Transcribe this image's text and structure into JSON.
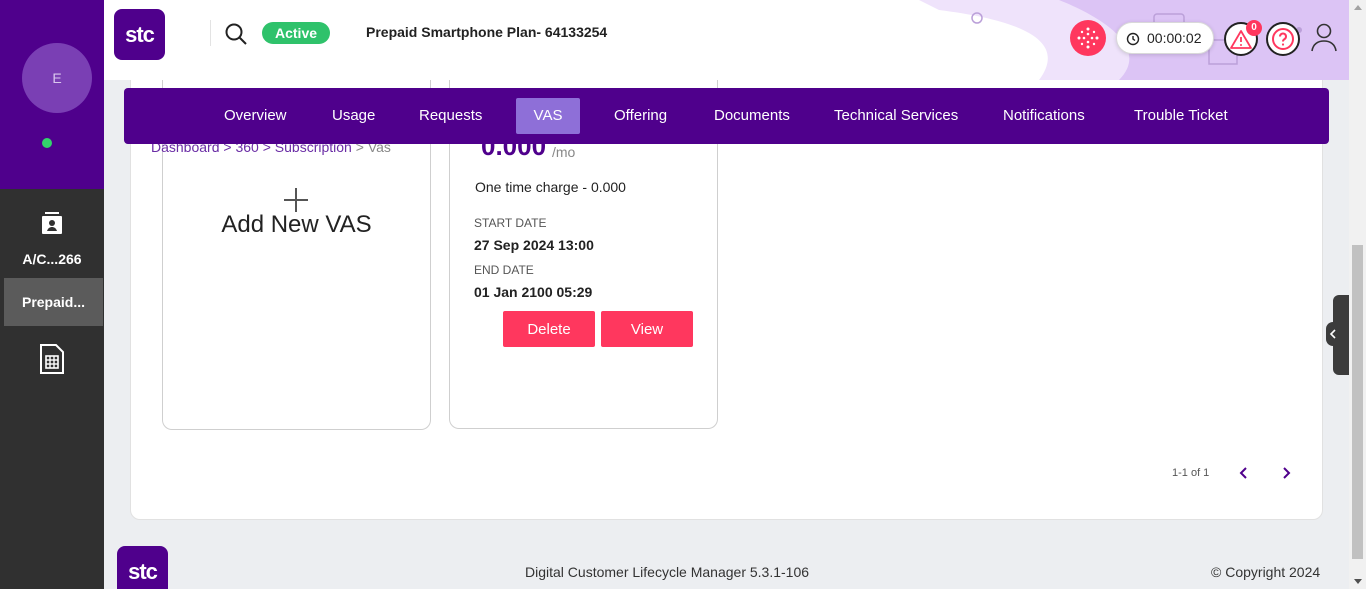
{
  "colors": {
    "brand": "#4f008c",
    "accent": "#ff375e",
    "active_tab": "#8e6fd8",
    "status_active": "#2fc26b"
  },
  "rail": {
    "avatar_initial": "E",
    "account_label": "A/C...266",
    "prepaid_label": "Prepaid..."
  },
  "header": {
    "logo_text": "stc",
    "status": "Active",
    "plan_title": "Prepaid Smartphone Plan- 64133254",
    "timer": "00:00:02",
    "alerts_count": "0"
  },
  "tabs": [
    {
      "label": "Overview"
    },
    {
      "label": "Usage"
    },
    {
      "label": "Requests"
    },
    {
      "label": "VAS",
      "active": true
    },
    {
      "label": "Offering"
    },
    {
      "label": "Documents"
    },
    {
      "label": "Technical Services"
    },
    {
      "label": "Notifications"
    },
    {
      "label": "Trouble Ticket"
    }
  ],
  "breadcrumb": {
    "dashboard": "Dashboard",
    "view360": "360",
    "subscription": "Subscription",
    "current": "Vas",
    "sep": ">"
  },
  "add_card": {
    "label": "Add New VAS"
  },
  "vas_card": {
    "price": "0.000",
    "per": "/mo",
    "one_time": "One time charge - 0.000",
    "start_label": "START DATE",
    "start_value": "27 Sep 2024 13:00",
    "end_label": "END DATE",
    "end_value": "01 Jan 2100 05:29",
    "delete_label": "Delete",
    "view_label": "View"
  },
  "pager": {
    "text": "1-1 of 1"
  },
  "footer": {
    "logo_text": "stc",
    "version": "Digital Customer Lifecycle Manager 5.3.1-106",
    "copyright": "Copyright 2024"
  }
}
